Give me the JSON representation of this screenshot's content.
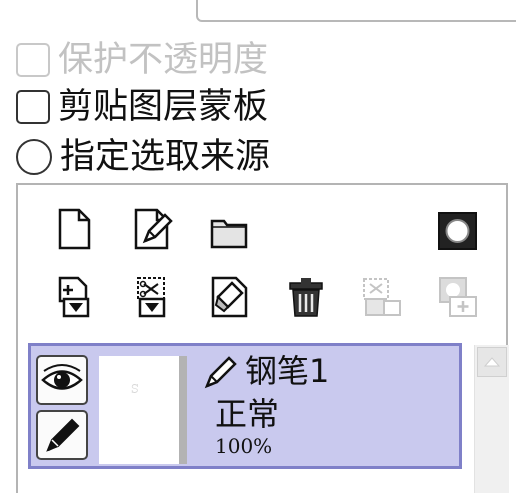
{
  "options": {
    "protect_opacity": {
      "label": "保护不透明度",
      "checked": false,
      "enabled": false
    },
    "clipping_mask": {
      "label": "剪贴图层蒙板",
      "checked": false,
      "enabled": true
    },
    "selection_source": {
      "label": "指定选取来源",
      "checked": false,
      "enabled": true
    }
  },
  "toolbar": {
    "row1": [
      "new-layer-icon",
      "new-pen-layer-icon",
      "new-folder-icon",
      "layer-mask-icon"
    ],
    "row2": [
      "transfer-down-icon",
      "merge-down-icon",
      "clear-layer-icon",
      "delete-layer-icon",
      "apply-selection-icon",
      "add-mask-icon"
    ]
  },
  "layer": {
    "type_icon": "pen-icon",
    "name": "钢笔1",
    "blend_mode": "正常",
    "opacity": "100%",
    "visible": true,
    "selected": true
  },
  "colors": {
    "selected_row_bg": "#c9c9ee",
    "selected_row_border": "#7f80c8",
    "disabled_text": "#c2c2c2"
  }
}
